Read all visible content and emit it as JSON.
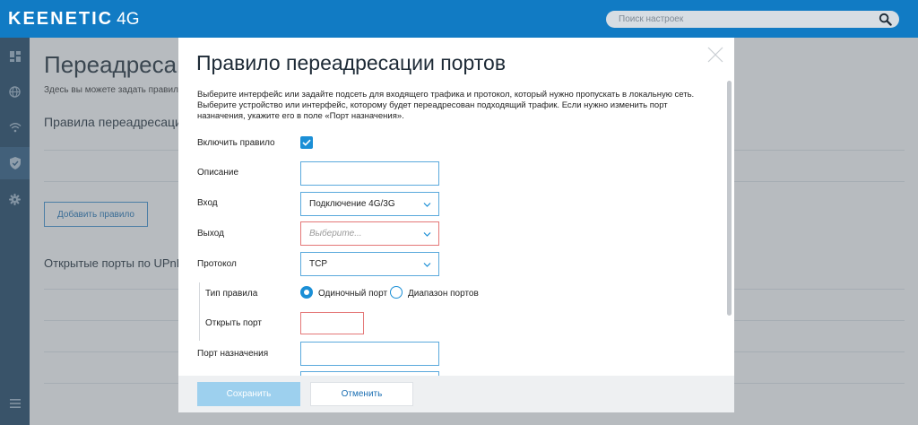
{
  "app": {
    "brand": "KEENETIC",
    "brand_suffix": "4G",
    "search_placeholder": "Поиск настроек"
  },
  "sidebar": {
    "items": [
      {
        "icon": "dashboard-icon"
      },
      {
        "icon": "globe-icon"
      },
      {
        "icon": "wifi-icon"
      },
      {
        "icon": "shield-icon",
        "active": true
      },
      {
        "icon": "gear-icon"
      },
      {
        "icon": "menu-icon"
      }
    ]
  },
  "background_page": {
    "title": "Переадресац",
    "description": "Здесь вы можете задать правила",
    "section_title": "Правила переадресации п",
    "add_button": "Добавить правило",
    "upnp_title": "Открытые порты по UPnP"
  },
  "modal": {
    "title": "Правило переадресации портов",
    "description": "Выберите интерфейс или задайте подсеть для входящего трафика и протокол, который нужно пропускать в локальную сеть. Выберите устройство или интерфейс, которому будет переадресован подходящий трафик. Если нужно изменить порт назначения, укажите его в поле «Порт назначения».",
    "enable_label": "Включить правило",
    "enable_checked": true,
    "description_label": "Описание",
    "description_value": "",
    "input_label": "Вход",
    "input_value": "Подключение 4G/3G",
    "output_label": "Выход",
    "output_placeholder": "Выберите...",
    "protocol_label": "Протокол",
    "protocol_value": "TCP",
    "rule_type_label": "Тип правила",
    "rule_type_options": [
      "Одиночный порт",
      "Диапазон портов"
    ],
    "rule_type_selected": "Одиночный порт",
    "open_port_label": "Открыть порт",
    "open_port_value": "",
    "dest_port_label": "Порт назначения",
    "dest_port_value": "",
    "save_button": "Сохранить",
    "cancel_button": "Отменить"
  },
  "colors": {
    "topbar": "#117bc4",
    "sidebar": "#1a4263",
    "accent": "#1b8fd6",
    "error": "#e47777",
    "save_disabled": "#9dd0ee"
  }
}
